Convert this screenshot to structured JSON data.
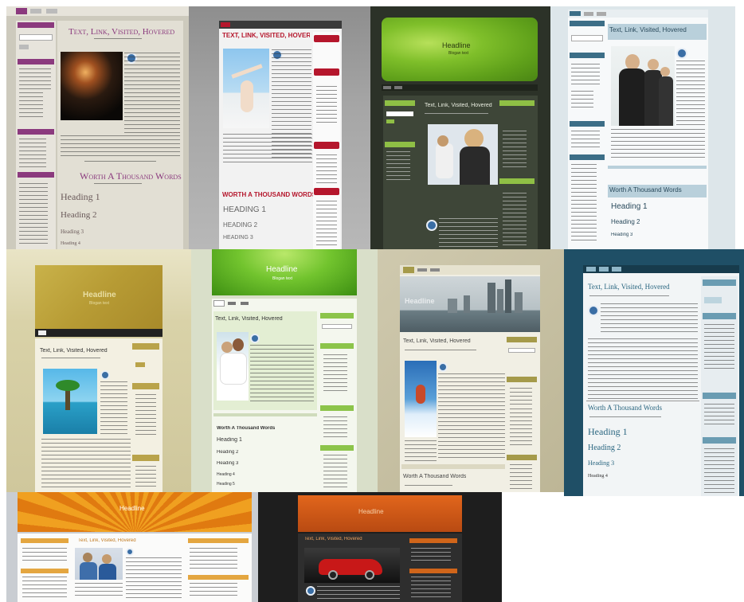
{
  "theme_1": {
    "post_title": "Text, Link, Visited, Hovered",
    "second_title": "Worth A Thousand Words",
    "heading_1": "Heading 1",
    "heading_2": "Heading 2",
    "heading_3": "Heading 3",
    "heading_4": "Heading 4"
  },
  "theme_2": {
    "post_title": "Text, Link, Visited, Hovered",
    "second_title": "Worth A Thousand Words",
    "heading_1": "Heading 1",
    "heading_2": "Heading 2",
    "heading_3": "Heading 3"
  },
  "theme_3": {
    "headline": "Headline",
    "tagline": "Blogan text",
    "post_title": "Text, Link, Visited, Hovered"
  },
  "theme_4": {
    "post_title": "Text, Link, Visited, Hovered",
    "second_title": "Worth A Thousand Words",
    "heading_1": "Heading 1",
    "heading_2": "Heading 2",
    "heading_3": "Heading 3"
  },
  "theme_5": {
    "headline": "Headline",
    "tagline": "Blogan text",
    "post_title": "Text, Link, Visited, Hovered"
  },
  "theme_6": {
    "headline": "Headline",
    "tagline": "Blogan text",
    "post_title": "Text, Link, Visited, Hovered",
    "second_title": "Worth A Thousand Words",
    "heading_1": "Heading 1",
    "heading_2": "Heading 2",
    "heading_3": "Heading 3",
    "heading_4": "Heading 4",
    "heading_5": "Heading 5"
  },
  "theme_7": {
    "headline": "Headline",
    "post_title": "Text, Link, Visited, Hovered",
    "second_title": "Worth A Thousand Words"
  },
  "theme_8": {
    "post_title": "Text, Link, Visited, Hovered",
    "second_title": "Worth A Thousand Words",
    "heading_1": "Heading 1",
    "heading_2": "Heading 2",
    "heading_3": "Heading 3",
    "heading_4": "Heading 4"
  },
  "theme_9": {
    "headline": "Headline",
    "post_title": "Text, Link, Visited, Hovered"
  },
  "theme_10": {
    "headline": "Headline",
    "post_title": "Text, Link, Visited, Hovered"
  }
}
